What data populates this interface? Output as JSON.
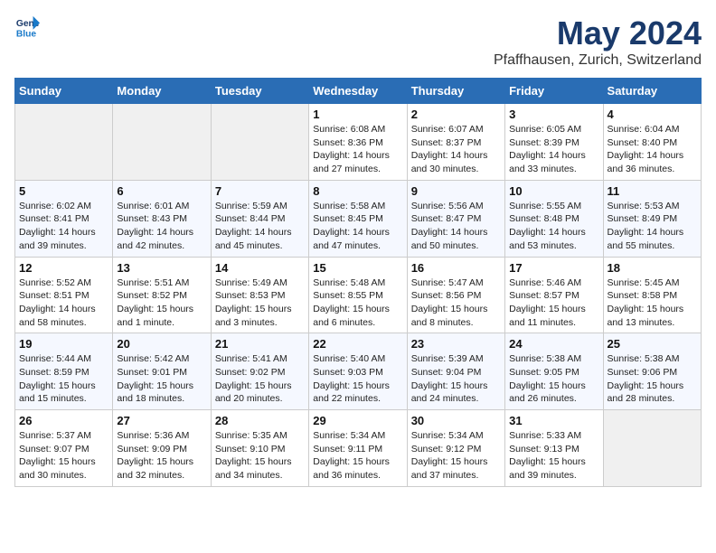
{
  "header": {
    "logo_line1": "General",
    "logo_line2": "Blue",
    "main_title": "May 2024",
    "subtitle": "Pfaffhausen, Zurich, Switzerland"
  },
  "days_of_week": [
    "Sunday",
    "Monday",
    "Tuesday",
    "Wednesday",
    "Thursday",
    "Friday",
    "Saturday"
  ],
  "weeks": [
    [
      {
        "day": "",
        "info": ""
      },
      {
        "day": "",
        "info": ""
      },
      {
        "day": "",
        "info": ""
      },
      {
        "day": "1",
        "info": "Sunrise: 6:08 AM\nSunset: 8:36 PM\nDaylight: 14 hours\nand 27 minutes."
      },
      {
        "day": "2",
        "info": "Sunrise: 6:07 AM\nSunset: 8:37 PM\nDaylight: 14 hours\nand 30 minutes."
      },
      {
        "day": "3",
        "info": "Sunrise: 6:05 AM\nSunset: 8:39 PM\nDaylight: 14 hours\nand 33 minutes."
      },
      {
        "day": "4",
        "info": "Sunrise: 6:04 AM\nSunset: 8:40 PM\nDaylight: 14 hours\nand 36 minutes."
      }
    ],
    [
      {
        "day": "5",
        "info": "Sunrise: 6:02 AM\nSunset: 8:41 PM\nDaylight: 14 hours\nand 39 minutes."
      },
      {
        "day": "6",
        "info": "Sunrise: 6:01 AM\nSunset: 8:43 PM\nDaylight: 14 hours\nand 42 minutes."
      },
      {
        "day": "7",
        "info": "Sunrise: 5:59 AM\nSunset: 8:44 PM\nDaylight: 14 hours\nand 45 minutes."
      },
      {
        "day": "8",
        "info": "Sunrise: 5:58 AM\nSunset: 8:45 PM\nDaylight: 14 hours\nand 47 minutes."
      },
      {
        "day": "9",
        "info": "Sunrise: 5:56 AM\nSunset: 8:47 PM\nDaylight: 14 hours\nand 50 minutes."
      },
      {
        "day": "10",
        "info": "Sunrise: 5:55 AM\nSunset: 8:48 PM\nDaylight: 14 hours\nand 53 minutes."
      },
      {
        "day": "11",
        "info": "Sunrise: 5:53 AM\nSunset: 8:49 PM\nDaylight: 14 hours\nand 55 minutes."
      }
    ],
    [
      {
        "day": "12",
        "info": "Sunrise: 5:52 AM\nSunset: 8:51 PM\nDaylight: 14 hours\nand 58 minutes."
      },
      {
        "day": "13",
        "info": "Sunrise: 5:51 AM\nSunset: 8:52 PM\nDaylight: 15 hours\nand 1 minute."
      },
      {
        "day": "14",
        "info": "Sunrise: 5:49 AM\nSunset: 8:53 PM\nDaylight: 15 hours\nand 3 minutes."
      },
      {
        "day": "15",
        "info": "Sunrise: 5:48 AM\nSunset: 8:55 PM\nDaylight: 15 hours\nand 6 minutes."
      },
      {
        "day": "16",
        "info": "Sunrise: 5:47 AM\nSunset: 8:56 PM\nDaylight: 15 hours\nand 8 minutes."
      },
      {
        "day": "17",
        "info": "Sunrise: 5:46 AM\nSunset: 8:57 PM\nDaylight: 15 hours\nand 11 minutes."
      },
      {
        "day": "18",
        "info": "Sunrise: 5:45 AM\nSunset: 8:58 PM\nDaylight: 15 hours\nand 13 minutes."
      }
    ],
    [
      {
        "day": "19",
        "info": "Sunrise: 5:44 AM\nSunset: 8:59 PM\nDaylight: 15 hours\nand 15 minutes."
      },
      {
        "day": "20",
        "info": "Sunrise: 5:42 AM\nSunset: 9:01 PM\nDaylight: 15 hours\nand 18 minutes."
      },
      {
        "day": "21",
        "info": "Sunrise: 5:41 AM\nSunset: 9:02 PM\nDaylight: 15 hours\nand 20 minutes."
      },
      {
        "day": "22",
        "info": "Sunrise: 5:40 AM\nSunset: 9:03 PM\nDaylight: 15 hours\nand 22 minutes."
      },
      {
        "day": "23",
        "info": "Sunrise: 5:39 AM\nSunset: 9:04 PM\nDaylight: 15 hours\nand 24 minutes."
      },
      {
        "day": "24",
        "info": "Sunrise: 5:38 AM\nSunset: 9:05 PM\nDaylight: 15 hours\nand 26 minutes."
      },
      {
        "day": "25",
        "info": "Sunrise: 5:38 AM\nSunset: 9:06 PM\nDaylight: 15 hours\nand 28 minutes."
      }
    ],
    [
      {
        "day": "26",
        "info": "Sunrise: 5:37 AM\nSunset: 9:07 PM\nDaylight: 15 hours\nand 30 minutes."
      },
      {
        "day": "27",
        "info": "Sunrise: 5:36 AM\nSunset: 9:09 PM\nDaylight: 15 hours\nand 32 minutes."
      },
      {
        "day": "28",
        "info": "Sunrise: 5:35 AM\nSunset: 9:10 PM\nDaylight: 15 hours\nand 34 minutes."
      },
      {
        "day": "29",
        "info": "Sunrise: 5:34 AM\nSunset: 9:11 PM\nDaylight: 15 hours\nand 36 minutes."
      },
      {
        "day": "30",
        "info": "Sunrise: 5:34 AM\nSunset: 9:12 PM\nDaylight: 15 hours\nand 37 minutes."
      },
      {
        "day": "31",
        "info": "Sunrise: 5:33 AM\nSunset: 9:13 PM\nDaylight: 15 hours\nand 39 minutes."
      },
      {
        "day": "",
        "info": ""
      }
    ]
  ]
}
